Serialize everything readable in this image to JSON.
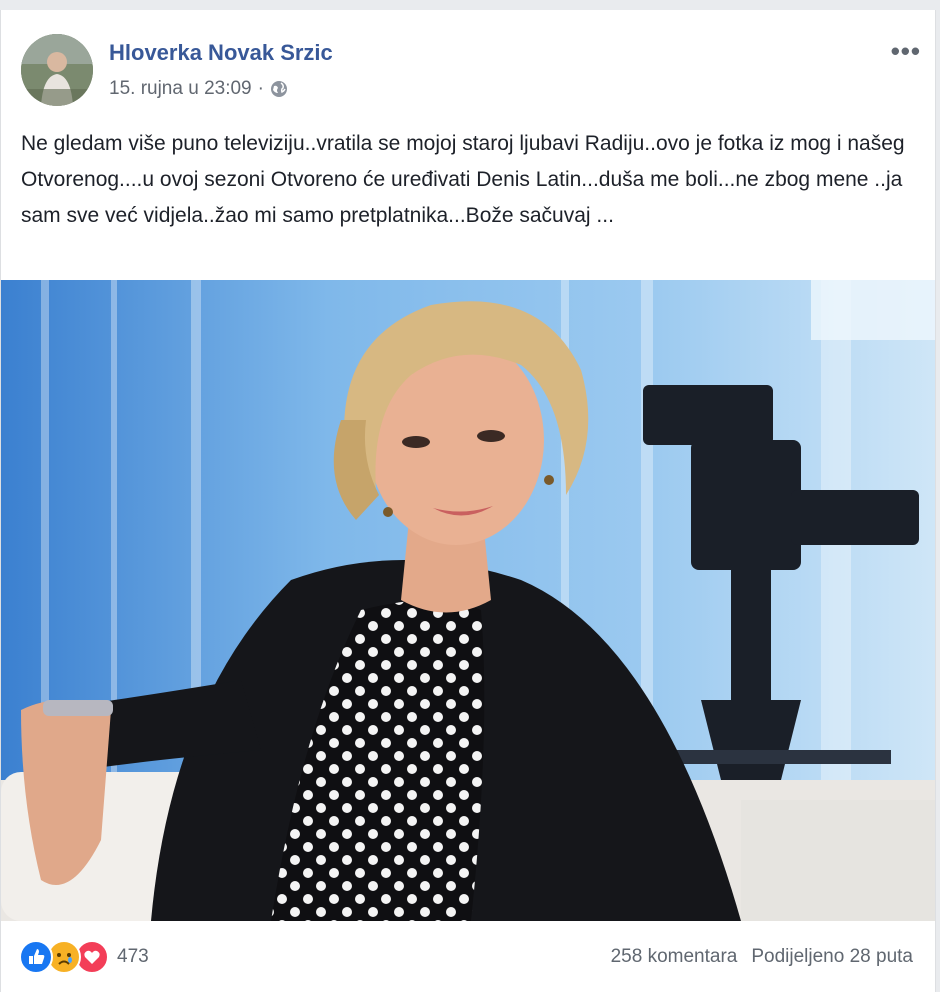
{
  "post": {
    "author": "Hloverka Novak Srzic",
    "timestamp": "15. rujna u 23:09",
    "separator": "·",
    "privacy_icon": "globe-icon",
    "more_label": "•••",
    "text": "Ne gledam više puno televiziju..vratila se mojoj staroj ljubavi Radiju..ovo je fotka iz mog i našeg Otvorenog....u ovoj sezoni Otvoreno će uređivati Denis Latin...duša me boli...ne zbog mene ..ja sam sve već vidjela..žao mi samo pretplatnika...Bože sačuvaj ..."
  },
  "footer": {
    "reactions": [
      "like-icon",
      "sad-icon",
      "love-icon"
    ],
    "reaction_count": "473",
    "comments": "258 komentara",
    "shares": "Podijeljeno 28 puta"
  },
  "colors": {
    "author": "#385898",
    "like": "#1877f2",
    "love": "#f33e58",
    "sad": "#f7b125"
  }
}
